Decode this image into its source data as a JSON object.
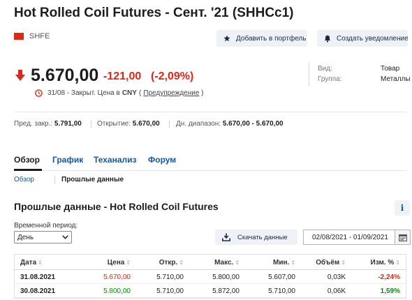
{
  "title": "Hot Rolled Coil Futures - Сент. '21 (SHHCc1)",
  "exchange": "SHFE",
  "actions": {
    "add_portfolio": "Добавить в портфель",
    "create_alert": "Создать уведомление"
  },
  "quote": {
    "last": "5.670,00",
    "change": "-121,00",
    "change_pct": "(-2,09%)",
    "status_date": "31/08",
    "status_text": "- Закрыт. Цена в",
    "currency": "CNY",
    "paren_open": "(",
    "warning_link": "Предупреждение",
    "paren_close": ")"
  },
  "info": {
    "type_label": "Вид:",
    "type_value": "Товар",
    "group_label": "Группа:",
    "group_value": "Металлы"
  },
  "stats": {
    "prev_close_label": "Пред. закр.:",
    "prev_close": "5.791,00",
    "open_label": "Открытие:",
    "open": "5.670,00",
    "day_range_label": "Дн. диапазон:",
    "day_range": "5.670,00 - 5.670,00"
  },
  "tabs": [
    "Обзор",
    "График",
    "Теханализ",
    "Форум"
  ],
  "subnav": {
    "overview": "Обзор",
    "historical": "Прошлые данные"
  },
  "section_title": "Прошлые данные - Hot Rolled Coil Futures",
  "info_icon_glyph": "i",
  "period": {
    "label": "Временной период:",
    "selected": "День"
  },
  "download_label": "Скачать данные",
  "date_range": "02/08/2021 - 01/09/2021",
  "table": {
    "headers": {
      "date": "Дата",
      "price": "Цена",
      "open": "Откр.",
      "high": "Макс.",
      "low": "Мин.",
      "volume": "Объём",
      "change": "Изм. %"
    },
    "sort_glyph": "⇕",
    "rows": [
      {
        "date": "31.08.2021",
        "price": "5.670,00",
        "open": "5.710,00",
        "high": "5.800,00",
        "low": "5.607,00",
        "volume": "0,03K",
        "change": "-2,24%",
        "direction": "down"
      },
      {
        "date": "30.08.2021",
        "price": "5.800,00",
        "open": "5.710,00",
        "high": "5.872,00",
        "low": "5.710,00",
        "volume": "0,06K",
        "change": "1,59%",
        "direction": "up"
      }
    ]
  },
  "colors": {
    "negative": "#e0261b",
    "positive": "#0a8a0a",
    "link": "#1256a5"
  }
}
